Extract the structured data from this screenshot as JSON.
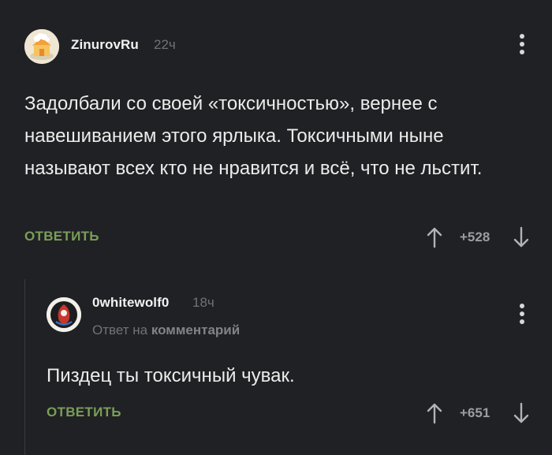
{
  "comments": [
    {
      "author": "ZinurovRu",
      "time": "22ч",
      "text": "Задолбали со своей «токсичностью», вернее с навешиванием этого ярлыка. Токсичными ныне называют всех кто не нравится и всё, что не льстит.",
      "reply_label": "ОТВЕТИТЬ",
      "rating": "+528",
      "avatar_icon": "cartoon-house-avatar"
    },
    {
      "author": "0whitewolf0",
      "time": "18ч",
      "reply_to_prefix": "Ответ на",
      "reply_to_target": "комментарий",
      "text": "Пиздец ты токсичный чувак.",
      "reply_label": "ОТВЕТИТЬ",
      "rating": "+651",
      "avatar_icon": "dark-emblem-avatar"
    }
  ],
  "colors": {
    "background": "#202124",
    "accent": "#7a9e58",
    "muted": "#6f7276",
    "text": "#ececec"
  }
}
